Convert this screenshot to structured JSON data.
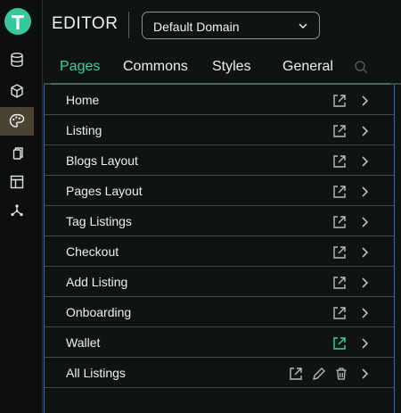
{
  "app": {
    "title": "EDITOR"
  },
  "domain": {
    "selected": "Default Domain"
  },
  "tabs": [
    {
      "label": "Pages",
      "active": true
    },
    {
      "label": "Commons",
      "active": false
    },
    {
      "label": "Styles",
      "active": false
    },
    {
      "label": "General",
      "active": false
    }
  ],
  "pages": [
    {
      "label": "Home"
    },
    {
      "label": "Listing"
    },
    {
      "label": "Blogs Layout"
    },
    {
      "label": "Pages Layout"
    },
    {
      "label": "Tag Listings"
    },
    {
      "label": "Checkout"
    },
    {
      "label": "Add Listing"
    },
    {
      "label": "Onboarding"
    },
    {
      "label": "Wallet",
      "open_highlighted": true
    },
    {
      "label": "All Listings",
      "hovered": true
    }
  ],
  "sidebar": {
    "icons": [
      "database-icon",
      "cube-icon",
      "palette-icon",
      "copy-icon",
      "layout-icon",
      "graph-icon"
    ],
    "active": "palette-icon"
  },
  "colors": {
    "accent": "#38d39f",
    "logo": "#36c79d",
    "active_rail": "#4a4332",
    "panel_border": "#2f6ad0"
  }
}
